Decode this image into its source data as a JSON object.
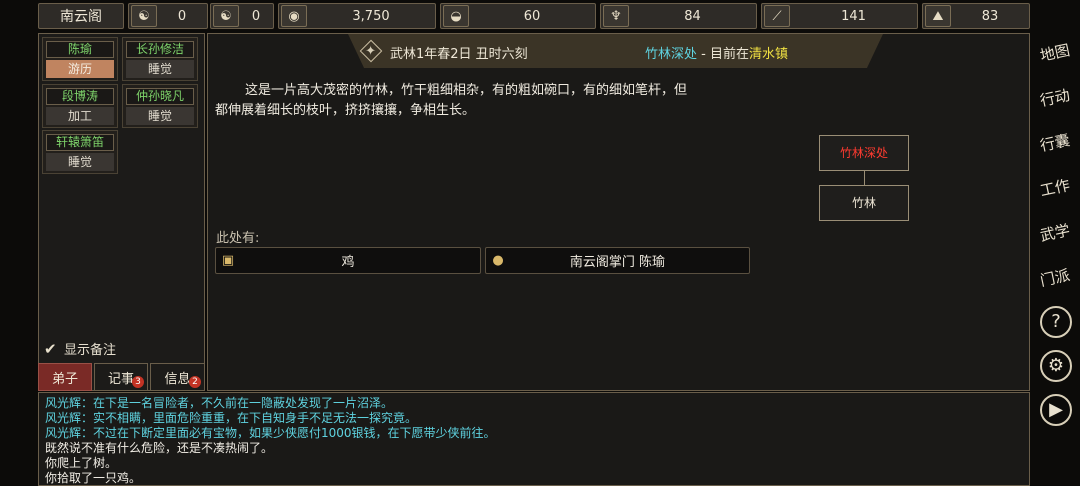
{
  "topbar": {
    "sect_name": "南云阁",
    "resources": [
      {
        "icon": "bagua-icon",
        "glyph": "☯",
        "value": "0"
      },
      {
        "icon": "yinyang-icon",
        "glyph": "☯",
        "value": "0"
      },
      {
        "icon": "coin-icon",
        "glyph": "◉",
        "value": "3,750"
      },
      {
        "icon": "food-icon",
        "glyph": "◒",
        "value": "60"
      },
      {
        "icon": "herb-icon",
        "glyph": "♆",
        "value": "84"
      },
      {
        "icon": "wood-icon",
        "glyph": "⟋",
        "value": "141"
      },
      {
        "icon": "ore-icon",
        "glyph": "⛰",
        "value": "83"
      }
    ]
  },
  "disciples": [
    {
      "name": "陈瑜",
      "activity": "游历",
      "active": true
    },
    {
      "name": "长孙修洁",
      "activity": "睡觉",
      "active": false
    },
    {
      "name": "段博涛",
      "activity": "加工",
      "active": false
    },
    {
      "name": "仲孙晓凡",
      "activity": "睡觉",
      "active": false
    },
    {
      "name": "轩辕箫笛",
      "activity": "睡觉",
      "active": false
    }
  ],
  "left": {
    "show_notes": "显示备注",
    "tabs": [
      {
        "label": "弟子",
        "badge": ""
      },
      {
        "label": "记事",
        "badge": "3"
      },
      {
        "label": "信息",
        "badge": "2"
      }
    ]
  },
  "header": {
    "date": "武林1年春2日 丑时六刻",
    "location": "竹林深处",
    "separator": " - 目前在",
    "town": "清水镇"
  },
  "scene": {
    "description": "这是一片高大茂密的竹林，竹干粗细相杂，有的粗如碗口，有的细如笔杆，但都伸展着细长的枝叶，挤挤攘攘，争相生长。",
    "here_label": "此处有:",
    "entities": [
      {
        "icon": "box-icon",
        "glyph": "▣",
        "label": "鸡"
      },
      {
        "icon": "person-icon",
        "glyph": "●",
        "label": "南云阁掌门 陈瑜"
      }
    ]
  },
  "minimap": {
    "current": "竹林深处",
    "neighbor": "竹林"
  },
  "sidemenu": [
    {
      "label": "地图"
    },
    {
      "label": "行动"
    },
    {
      "label": "行囊"
    },
    {
      "label": "工作"
    },
    {
      "label": "武学"
    },
    {
      "label": "门派"
    },
    {
      "label": "?"
    },
    {
      "label": "⚙"
    },
    {
      "label": "▶"
    }
  ],
  "log": [
    {
      "text": "风光辉：在下是一名冒险者，不久前在一隐蔽处发现了一片沼泽。",
      "color": "cyan"
    },
    {
      "text": "风光辉：实不相瞒，里面危险重重，在下自知身手不足无法一探究竟。",
      "color": "cyan"
    },
    {
      "text": "风光辉：不过在下断定里面必有宝物，如果少侠愿付1000银钱，在下愿带少侠前往。",
      "color": "cyan"
    },
    {
      "text": "既然说不准有什么危险，还是不凑热闹了。",
      "color": "white"
    },
    {
      "text": "你爬上了树。",
      "color": "white"
    },
    {
      "text": "你拾取了一只鸡。",
      "color": "white"
    }
  ]
}
